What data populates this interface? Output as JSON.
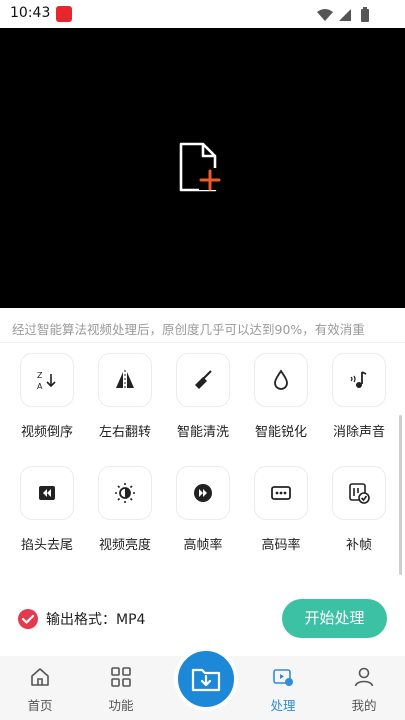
{
  "status_bar": {
    "time": "10:43"
  },
  "preview": {},
  "description": "经过智能算法视频处理后，原创度几乎可以达到90%，有效消重",
  "tools_row1": [
    {
      "label": "视频倒序",
      "icon": "reverse-sort-icon"
    },
    {
      "label": "左右翻转",
      "icon": "flip-horizontal-icon"
    },
    {
      "label": "智能清洗",
      "icon": "broom-icon"
    },
    {
      "label": "智能锐化",
      "icon": "drop-icon"
    },
    {
      "label": "消除声音",
      "icon": "mute-music-icon"
    }
  ],
  "tools_row2": [
    {
      "label": "掐头去尾",
      "icon": "skip-back-icon"
    },
    {
      "label": "视频亮度",
      "icon": "brightness-icon"
    },
    {
      "label": "高帧率",
      "icon": "fast-forward-icon"
    },
    {
      "label": "高码率",
      "icon": "bitrate-icon"
    },
    {
      "label": "补帧",
      "icon": "frame-check-icon"
    }
  ],
  "output_format": {
    "label": "输出格式：MP4"
  },
  "start_button": {
    "label": "开始处理"
  },
  "bottom_nav": [
    {
      "label": "首页",
      "icon": "home-icon"
    },
    {
      "label": "功能",
      "icon": "grid-icon"
    },
    {
      "label": "处理",
      "icon": "process-icon",
      "active": true
    },
    {
      "label": "我的",
      "icon": "user-icon"
    }
  ],
  "colors": {
    "accent": "#3cc1a4",
    "blue": "#1e88d8",
    "active_nav": "#2e8fd8",
    "check": "#e53a4d",
    "file_plus": "#f05a28"
  }
}
